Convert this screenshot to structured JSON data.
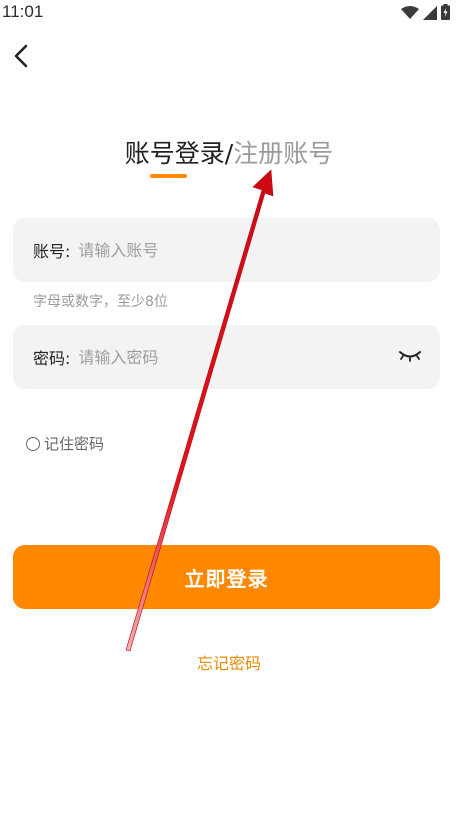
{
  "status_bar": {
    "time": "11:01",
    "icons": [
      "wifi-icon",
      "signal-icon",
      "battery-charging-icon"
    ]
  },
  "header": {
    "back_icon": "chevron-left-icon"
  },
  "title": {
    "active_tab": "账号登录",
    "separator": "/",
    "inactive_tab": "注册账号"
  },
  "account": {
    "label": "账号:",
    "placeholder": "请输入账号",
    "hint": "字母或数字，至少8位"
  },
  "password": {
    "label": "密码:",
    "placeholder": "请输入密码",
    "toggle_icon": "eye-closed-icon"
  },
  "remember": {
    "label": "记住密码",
    "checked": false
  },
  "actions": {
    "login_label": "立即登录",
    "forgot_label": "忘记密码"
  },
  "colors": {
    "accent": "#ff8800",
    "annotation_arrow": "#e0141e"
  }
}
